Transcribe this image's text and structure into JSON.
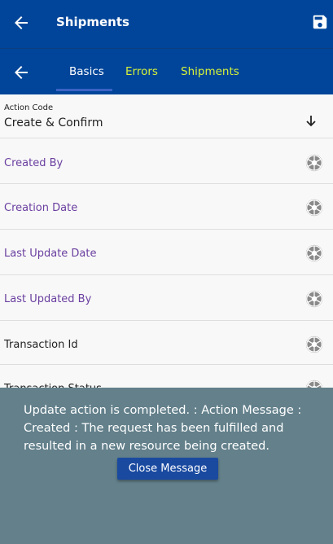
{
  "header": {
    "title": "Shipments"
  },
  "tabs": {
    "basics": "Basics",
    "errors": "Errors",
    "shipments": "Shipments"
  },
  "form": {
    "action_code_label": "Action Code",
    "action_code_value": "Create & Confirm",
    "fields": [
      {
        "label": "Created By"
      },
      {
        "label": "Creation Date"
      },
      {
        "label": "Last Update Date"
      },
      {
        "label": "Last Updated By"
      },
      {
        "label": "Transaction Id"
      },
      {
        "label": "Transaction Status"
      }
    ]
  },
  "toast": {
    "message": "Update action is completed.  : Action Message : Created : The request has been fulfilled and resulted in a new resource being created.",
    "button_label": "Close Message"
  },
  "colors": {
    "primary": "#004599",
    "tab_accent": "#d6f23a",
    "label_purple": "#6a3fa0",
    "toast_bg": "#63808b",
    "button_bg": "#1a4aa0"
  },
  "icons": {
    "back": "arrow-left-icon",
    "save": "save-icon",
    "dropdown": "arrow-down-icon",
    "field_action": "aperture-icon"
  }
}
